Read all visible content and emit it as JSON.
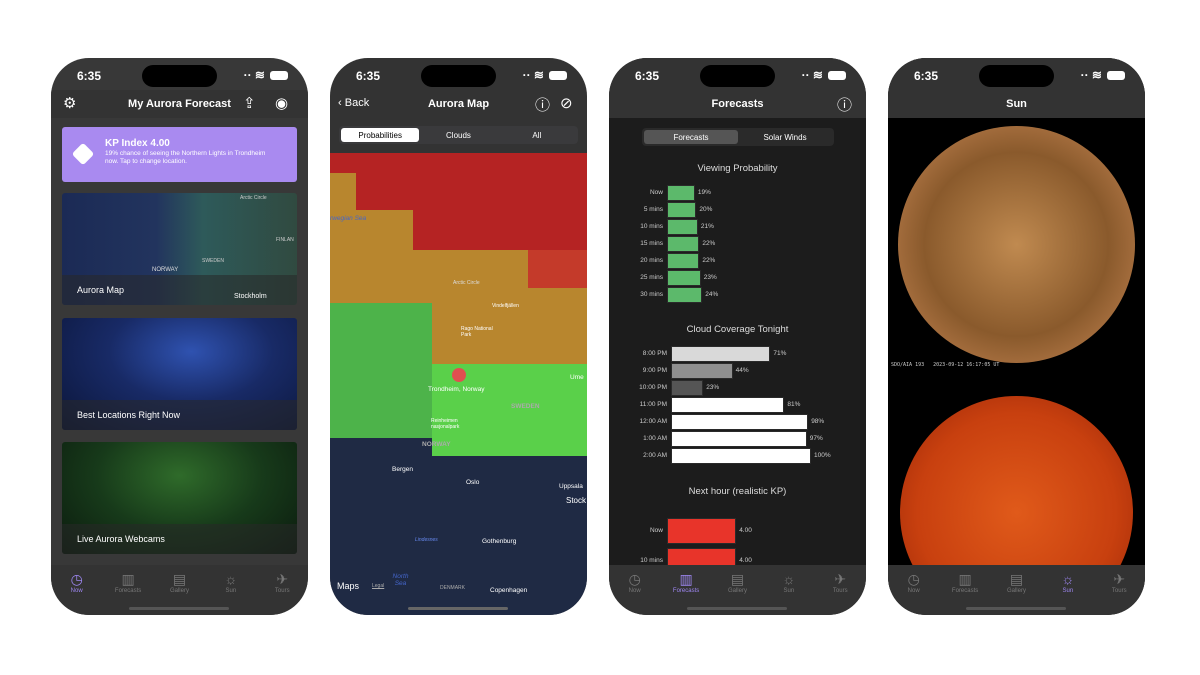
{
  "status_time": "6:35",
  "tabs": [
    {
      "label": "Now",
      "icon": "clock-icon"
    },
    {
      "label": "Forecasts",
      "icon": "chart-icon"
    },
    {
      "label": "Gallery",
      "icon": "gallery-icon"
    },
    {
      "label": "Sun",
      "icon": "sun-icon"
    },
    {
      "label": "Tours",
      "icon": "plane-icon"
    }
  ],
  "now": {
    "title": "My Aurora Forecast",
    "kp_title": "KP Index 4.00",
    "kp_text": "19% chance of seeing the Northern Lights in Trondheim now. Tap to change location.",
    "cards": [
      "Aurora Map",
      "Best Locations Right Now",
      "Live Aurora Webcams"
    ],
    "map_labels": [
      "Arctic Circle",
      "SWEDEN",
      "FINLAN",
      "NORWAY",
      "Stockholm"
    ],
    "accent": "#a98af0"
  },
  "map": {
    "back": "Back",
    "title": "Aurora Map",
    "segments": [
      "Probabilities",
      "Clouds",
      "All"
    ],
    "labels": {
      "sea": "rwegian Sea",
      "arctic": "Arctic Circle",
      "park1": "Vindelfjällen",
      "park2": "Rago National Park",
      "pin": "Trondheim, Norway",
      "sweden": "SWEDEN",
      "norway": "NORWAY",
      "park3": "Reinheimen nasjonalpark",
      "bergen": "Bergen",
      "oslo": "Oslo",
      "uppsala": "Uppsala",
      "stock": "Stock",
      "lindesnes": "Lindesnes",
      "gothenburg": "Gothenburg",
      "north_sea": "North Sea",
      "denmark": "DENMARK",
      "copenhagen": "Copenhagen",
      "ume": "Ume",
      "maps": "Maps",
      "legal": "Legal"
    }
  },
  "forecasts": {
    "title": "Forecasts",
    "segments": [
      "Forecasts",
      "Solar Winds"
    ]
  },
  "chart_data": [
    {
      "type": "bar",
      "title": "Viewing Probability",
      "categories": [
        "Now",
        "5 mins",
        "10 mins",
        "15 mins",
        "20 mins",
        "25 mins",
        "30 mins"
      ],
      "values": [
        19,
        20,
        21,
        22,
        22,
        23,
        24
      ],
      "labels": [
        "19%",
        "20%",
        "21%",
        "22%",
        "22%",
        "23%",
        "24%"
      ],
      "color": "#5cb96b"
    },
    {
      "type": "bar",
      "title": "Cloud Coverage Tonight",
      "categories": [
        "8:00 PM",
        "9:00 PM",
        "10:00 PM",
        "11:00 PM",
        "12:00 AM",
        "1:00 AM",
        "2:00 AM"
      ],
      "values": [
        71,
        44,
        23,
        81,
        98,
        97,
        100
      ],
      "labels": [
        "71%",
        "44%",
        "23%",
        "81%",
        "98%",
        "97%",
        "100%"
      ],
      "colors": [
        "#d9d9d9",
        "#8f8f8f",
        "#555555",
        "#ffffff",
        "#ffffff",
        "#ffffff",
        "#ffffff"
      ]
    },
    {
      "type": "bar",
      "title": "Next hour (realistic KP)",
      "categories": [
        "Now",
        "10 mins"
      ],
      "values": [
        4.0,
        4.0
      ],
      "labels": [
        "4.00",
        "4.00"
      ],
      "color": "#e8342a"
    }
  ],
  "sun": {
    "title": "Sun",
    "caption": "SDO/AIA 193   2023-09-12 16:17:05 UT"
  }
}
